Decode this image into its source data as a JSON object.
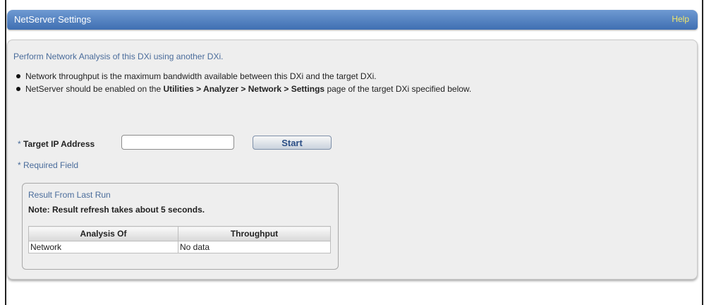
{
  "header": {
    "title": "NetServer Settings",
    "help_label": "Help"
  },
  "intro": "Perform Network Analysis of this DXi using another DXi.",
  "bullets": {
    "b1": "Network throughput is the maximum bandwidth available between this DXi and the target DXi.",
    "b2_pre": "NetServer should be enabled on the ",
    "b2_bold": "Utilities > Analyzer > Network > Settings",
    "b2_post": " page of the target DXi specified below."
  },
  "form": {
    "required_mark": "* ",
    "target_ip_label": "Target IP Address",
    "target_ip_value": "",
    "start_label": "Start",
    "required_field_note": "* Required Field"
  },
  "results": {
    "title": "Result From Last Run",
    "note": "Note: Result refresh takes about 5 seconds.",
    "columns": [
      "Analysis Of",
      "Throughput"
    ],
    "rows": [
      [
        "Network",
        "No data"
      ]
    ]
  },
  "colors": {
    "accent": "#4a6c9b",
    "header_bg": "#5683c3",
    "help_link": "#f2e86a"
  }
}
